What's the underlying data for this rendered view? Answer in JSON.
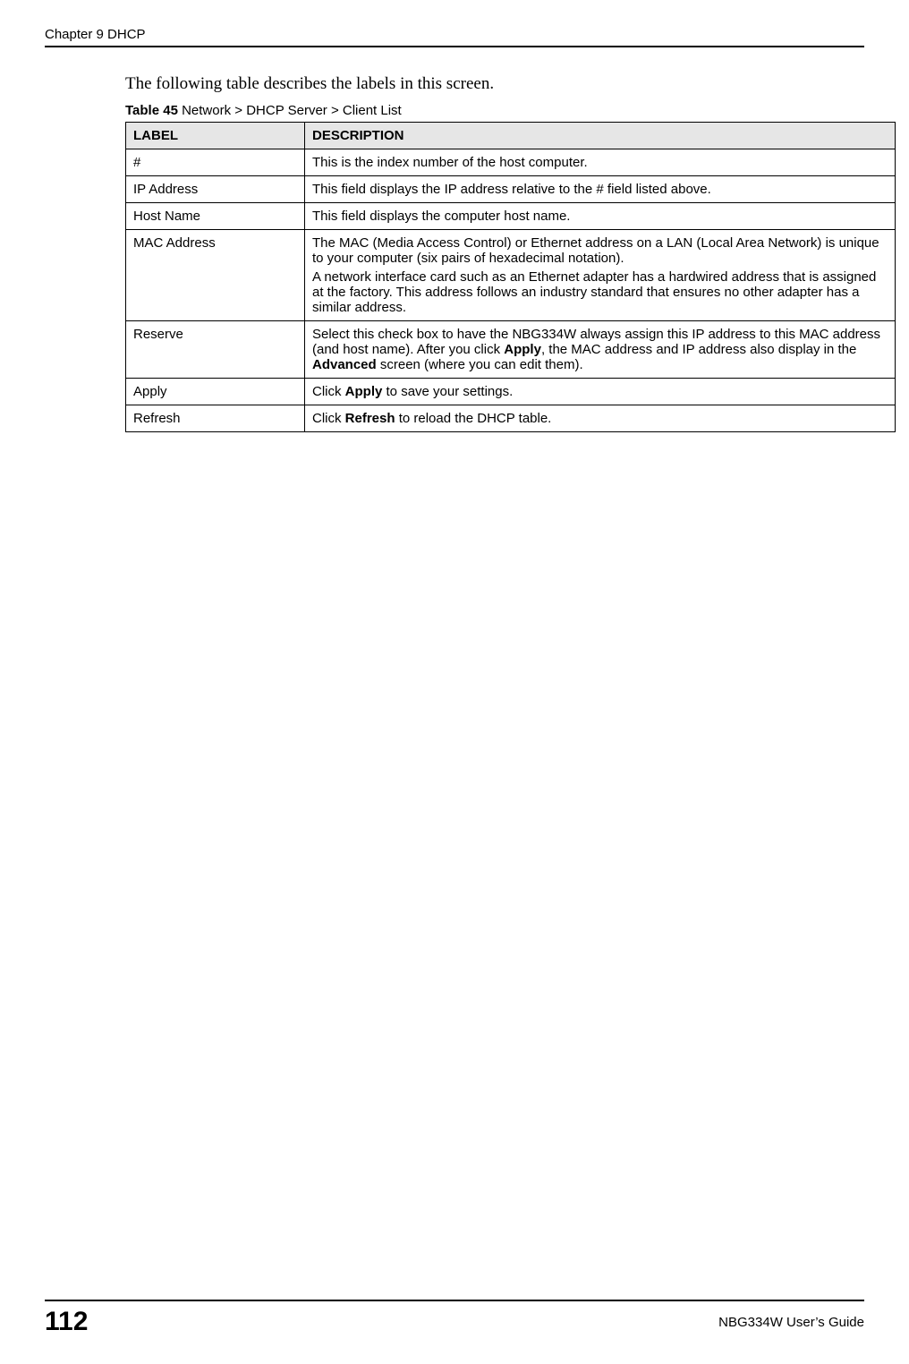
{
  "header": {
    "chapter": "Chapter 9 DHCP"
  },
  "intro": "The following table describes the labels in this screen.",
  "tableTitle": {
    "prefix": "Table 45",
    "rest": "   Network > DHCP Server > Client List"
  },
  "tableHeaders": {
    "label": "LABEL",
    "description": "DESCRIPTION"
  },
  "rows": {
    "r0": {
      "label": "#",
      "desc": "This is the index number of the host computer."
    },
    "r1": {
      "label": "IP Address",
      "desc": "This field displays the IP address relative to the # field listed above."
    },
    "r2": {
      "label": "Host Name",
      "desc": "This field displays the computer host name."
    },
    "r3": {
      "label": "MAC Address",
      "desc_p1": "The MAC (Media Access Control) or Ethernet address on a LAN (Local Area Network) is unique to your computer (six pairs of hexadecimal notation).",
      "desc_p2": "A network interface card such as an Ethernet adapter has a hardwired address that is assigned at the factory. This address follows an industry standard that ensures no other adapter has a similar address."
    },
    "r4": {
      "label": "Reserve",
      "desc_seg1": "Select this check box to have the NBG334W always assign this IP address to this MAC address (and host name). After you click ",
      "desc_b1": "Apply",
      "desc_seg2": ", the MAC address and IP address also display in the ",
      "desc_b2": "Advanced",
      "desc_seg3": " screen (where you can edit them)."
    },
    "r5": {
      "label": "Apply",
      "desc_seg1": "Click ",
      "desc_b1": "Apply",
      "desc_seg2": " to save your settings."
    },
    "r6": {
      "label": "Refresh",
      "desc_seg1": "Click ",
      "desc_b1": "Refresh",
      "desc_seg2": " to reload the DHCP table."
    }
  },
  "footer": {
    "page": "112",
    "guide": "NBG334W User’s Guide"
  }
}
